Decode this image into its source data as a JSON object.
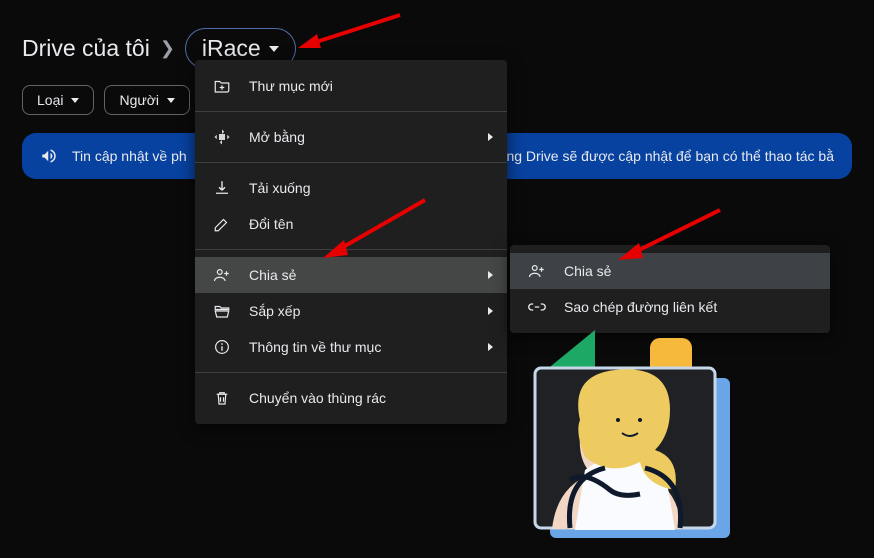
{
  "breadcrumb": {
    "root": "Drive của tôi",
    "current": "iRace"
  },
  "filters": {
    "type": "Loại",
    "people": "Người"
  },
  "banner": {
    "text_before": "Tin cập nhật về ph",
    "text_after": "trong Drive sẽ được cập nhật để bạn có thể thao tác bằ"
  },
  "menu": {
    "new_folder": "Thư mục mới",
    "open_with": "Mở bằng",
    "download": "Tải xuống",
    "rename": "Đổi tên",
    "share": "Chia sẻ",
    "organize": "Sắp xếp",
    "folder_info": "Thông tin về thư mục",
    "trash": "Chuyển vào thùng rác"
  },
  "submenu": {
    "share": "Chia sẻ",
    "copy_link": "Sao chép đường liên kết"
  }
}
